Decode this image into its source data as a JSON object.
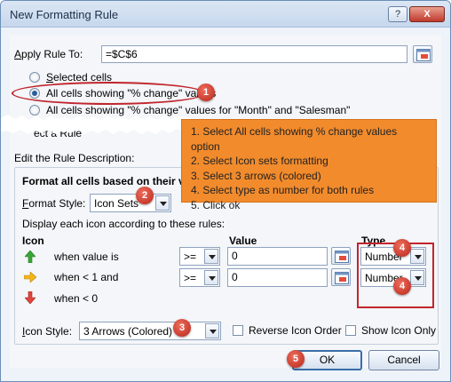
{
  "window": {
    "title": "New Formatting Rule",
    "help_label": "?",
    "close_label": "X"
  },
  "apply_rule": {
    "label_prefix": "A",
    "label_rest": "pply Rule To:",
    "value": "=$C$6"
  },
  "radios": [
    {
      "label_prefix": "S",
      "label_rest": "elected cells",
      "selected": false
    },
    {
      "label_prefix": "",
      "label_rest": "All cells showing \"% change\" values",
      "selected": true
    },
    {
      "label_prefix": "",
      "label_rest": "All cells showing \"% change\" values for \"Month\" and \"Salesman\"",
      "selected": false
    }
  ],
  "partial_label": "ect a Rule",
  "edit_description": {
    "label": "Edit the Rule Description:",
    "heading": "Format all cells based on their v"
  },
  "format_style": {
    "label_prefix": "F",
    "label_rest": "ormat Style:",
    "value": "Icon Sets"
  },
  "display_text": "Display each icon according to these rules:",
  "columns": {
    "icon": "Icon",
    "value": "Value",
    "type": "Type"
  },
  "rules": [
    {
      "icon": "green-up-arrow-icon",
      "condition": "when value is",
      "operator": ">=",
      "value": "0",
      "type": "Number"
    },
    {
      "icon": "yellow-right-arrow-icon",
      "condition": "when < 1 and",
      "operator": ">=",
      "value": "0",
      "type": "Number"
    },
    {
      "icon": "red-down-arrow-icon",
      "condition": "when < 0"
    }
  ],
  "icon_style": {
    "label_prefix": "I",
    "label_rest": "con Style:",
    "value": "3 Arrows (Colored)"
  },
  "reverse_icon_order": {
    "label": "Reverse Icon Order",
    "checked": false
  },
  "show_icon_only": {
    "label": "Show Icon Only",
    "checked": false
  },
  "buttons": {
    "ok": "OK",
    "cancel": "Cancel"
  },
  "callout": {
    "steps": [
      "1. Select All cells showing % change values option",
      "2. Select Icon sets formatting",
      "3. Select 3 arrows (colored)",
      "4. Select type as number for both rules",
      "5. Click ok"
    ]
  },
  "badges": [
    "1",
    "2",
    "3",
    "4",
    "4",
    "5"
  ],
  "colors": {
    "accent_red": "#c0262d",
    "callout_orange": "#f28b2c",
    "arrow_green": "#3aa535",
    "arrow_yellow": "#f2b51c",
    "arrow_red": "#e0443a"
  }
}
